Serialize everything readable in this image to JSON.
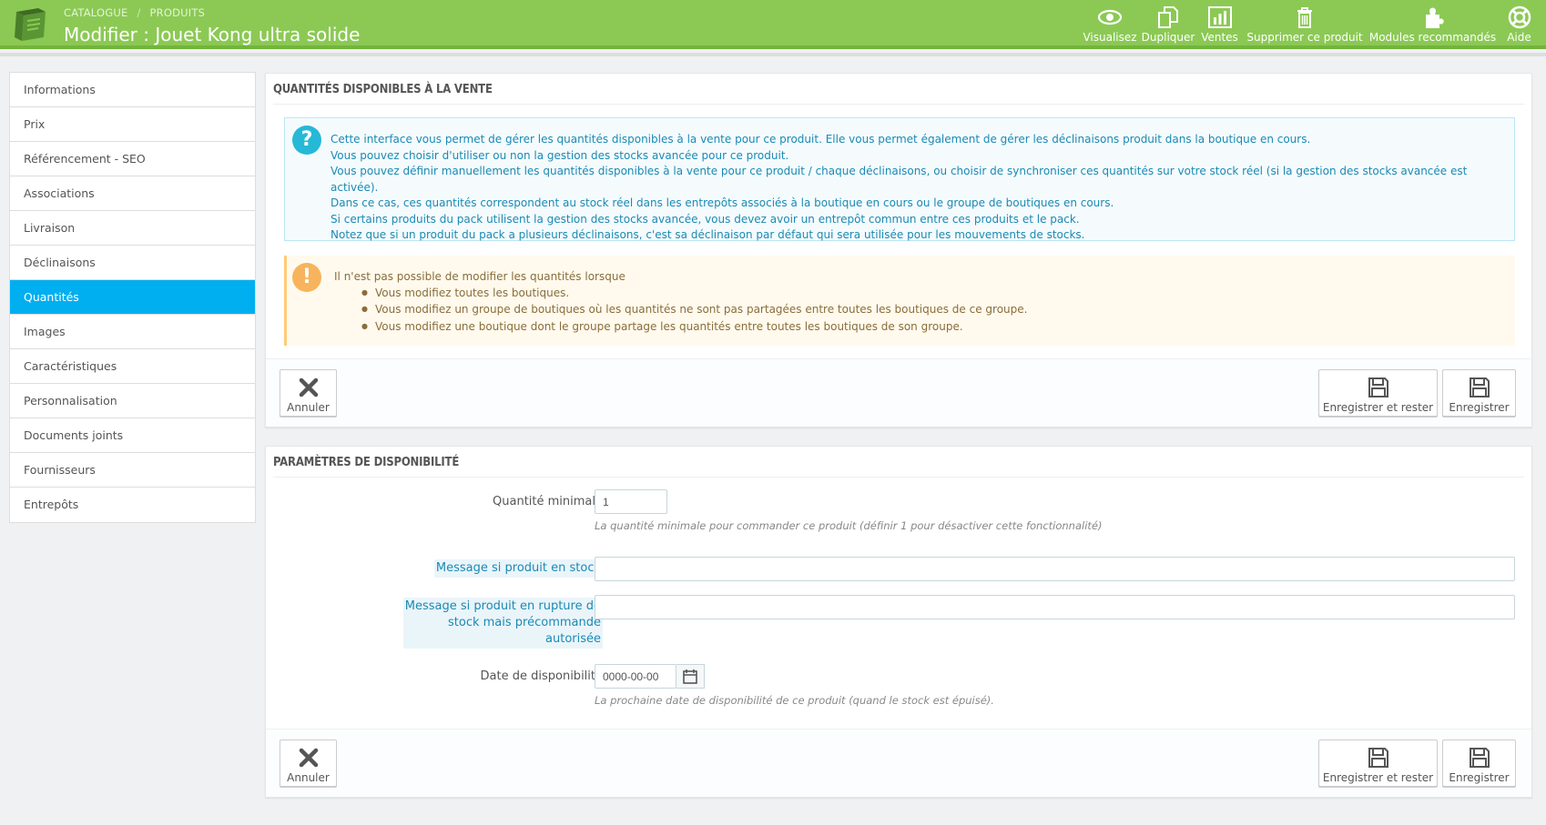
{
  "header": {
    "breadcrumb": [
      "CATALOGUE",
      "PRODUITS"
    ],
    "breadcrumb_sep": "/",
    "title": "Modifier : Jouet Kong ultra solide",
    "toolbar": [
      {
        "label": "Visualisez",
        "icon": "eye-icon"
      },
      {
        "label": "Dupliquer",
        "icon": "copy-icon"
      },
      {
        "label": "Ventes",
        "icon": "bar-chart-icon"
      },
      {
        "label": "Supprimer ce produit",
        "icon": "trash-icon"
      },
      {
        "label": "Modules recommandés",
        "icon": "puzzle-icon"
      },
      {
        "label": "Aide",
        "icon": "lifebuoy-icon"
      }
    ]
  },
  "sidebar": {
    "items": [
      {
        "label": "Informations"
      },
      {
        "label": "Prix"
      },
      {
        "label": "Référencement - SEO"
      },
      {
        "label": "Associations"
      },
      {
        "label": "Livraison"
      },
      {
        "label": "Déclinaisons"
      },
      {
        "label": "Quantités",
        "active": true
      },
      {
        "label": "Images"
      },
      {
        "label": "Caractéristiques"
      },
      {
        "label": "Personnalisation"
      },
      {
        "label": "Documents joints"
      },
      {
        "label": "Fournisseurs"
      },
      {
        "label": "Entrepôts"
      }
    ]
  },
  "quantities_panel": {
    "title": "QUANTITÉS DISPONIBLES À LA VENTE",
    "info_lines": [
      "Cette interface vous permet de gérer les quantités disponibles à la vente pour ce produit. Elle vous permet également de gérer les déclinaisons produit dans la boutique en cours.",
      "Vous pouvez choisir d'utiliser ou non la gestion des stocks avancée pour ce produit.",
      "Vous pouvez définir manuellement les quantités disponibles à la vente pour ce produit / chaque déclinaisons, ou choisir de synchroniser ces quantités sur votre stock réel (si la gestion des stocks avancée est activée).",
      "Dans ce cas, ces quantités correspondent au stock réel dans les entrepôts associés à la boutique en cours ou le groupe de boutiques en cours.",
      "Si certains produits du pack utilisent la gestion des stocks avancée, vous devez avoir un entrepôt commun entre ces produits et le pack.",
      "Notez que si un produit du pack a plusieurs déclinaisons, c'est sa déclinaison par défaut qui sera utilisée pour les mouvements de stocks."
    ],
    "warning_intro": "Il n'est pas possible de modifier les quantités lorsque",
    "warning_items": [
      "Vous modifiez toutes les boutiques.",
      "Vous modifiez un groupe de boutiques où les quantités ne sont pas partagées entre toutes les boutiques de ce groupe.",
      "Vous modifiez une boutique dont le groupe partage les quantités entre toutes les boutiques de son groupe."
    ]
  },
  "availability_panel": {
    "title": "PARAMÈTRES DE DISPONIBILITÉ",
    "min_qty_label": "Quantité minimale",
    "min_qty_value": "1",
    "min_qty_help": "La quantité minimale pour commander ce produit (définir 1 pour désactiver cette fonctionnalité)",
    "in_stock_label": "Message si produit en stock",
    "in_stock_value": "",
    "oos_label_lines": [
      "Message si produit en rupture de",
      "stock mais précommande",
      "autorisée"
    ],
    "oos_value": "",
    "date_label": "Date de disponibilité",
    "date_value": "0000-00-00",
    "date_help": "La prochaine date de disponibilité de ce produit (quand le stock est épuisé)."
  },
  "buttons": {
    "cancel": "Annuler",
    "save_stay": "Enregistrer et rester",
    "save": "Enregistrer"
  },
  "colors": {
    "header": "#8bc954",
    "active_tab": "#00aff0",
    "info_text": "#1a8ab4",
    "warning_bg": "#fffaed"
  }
}
